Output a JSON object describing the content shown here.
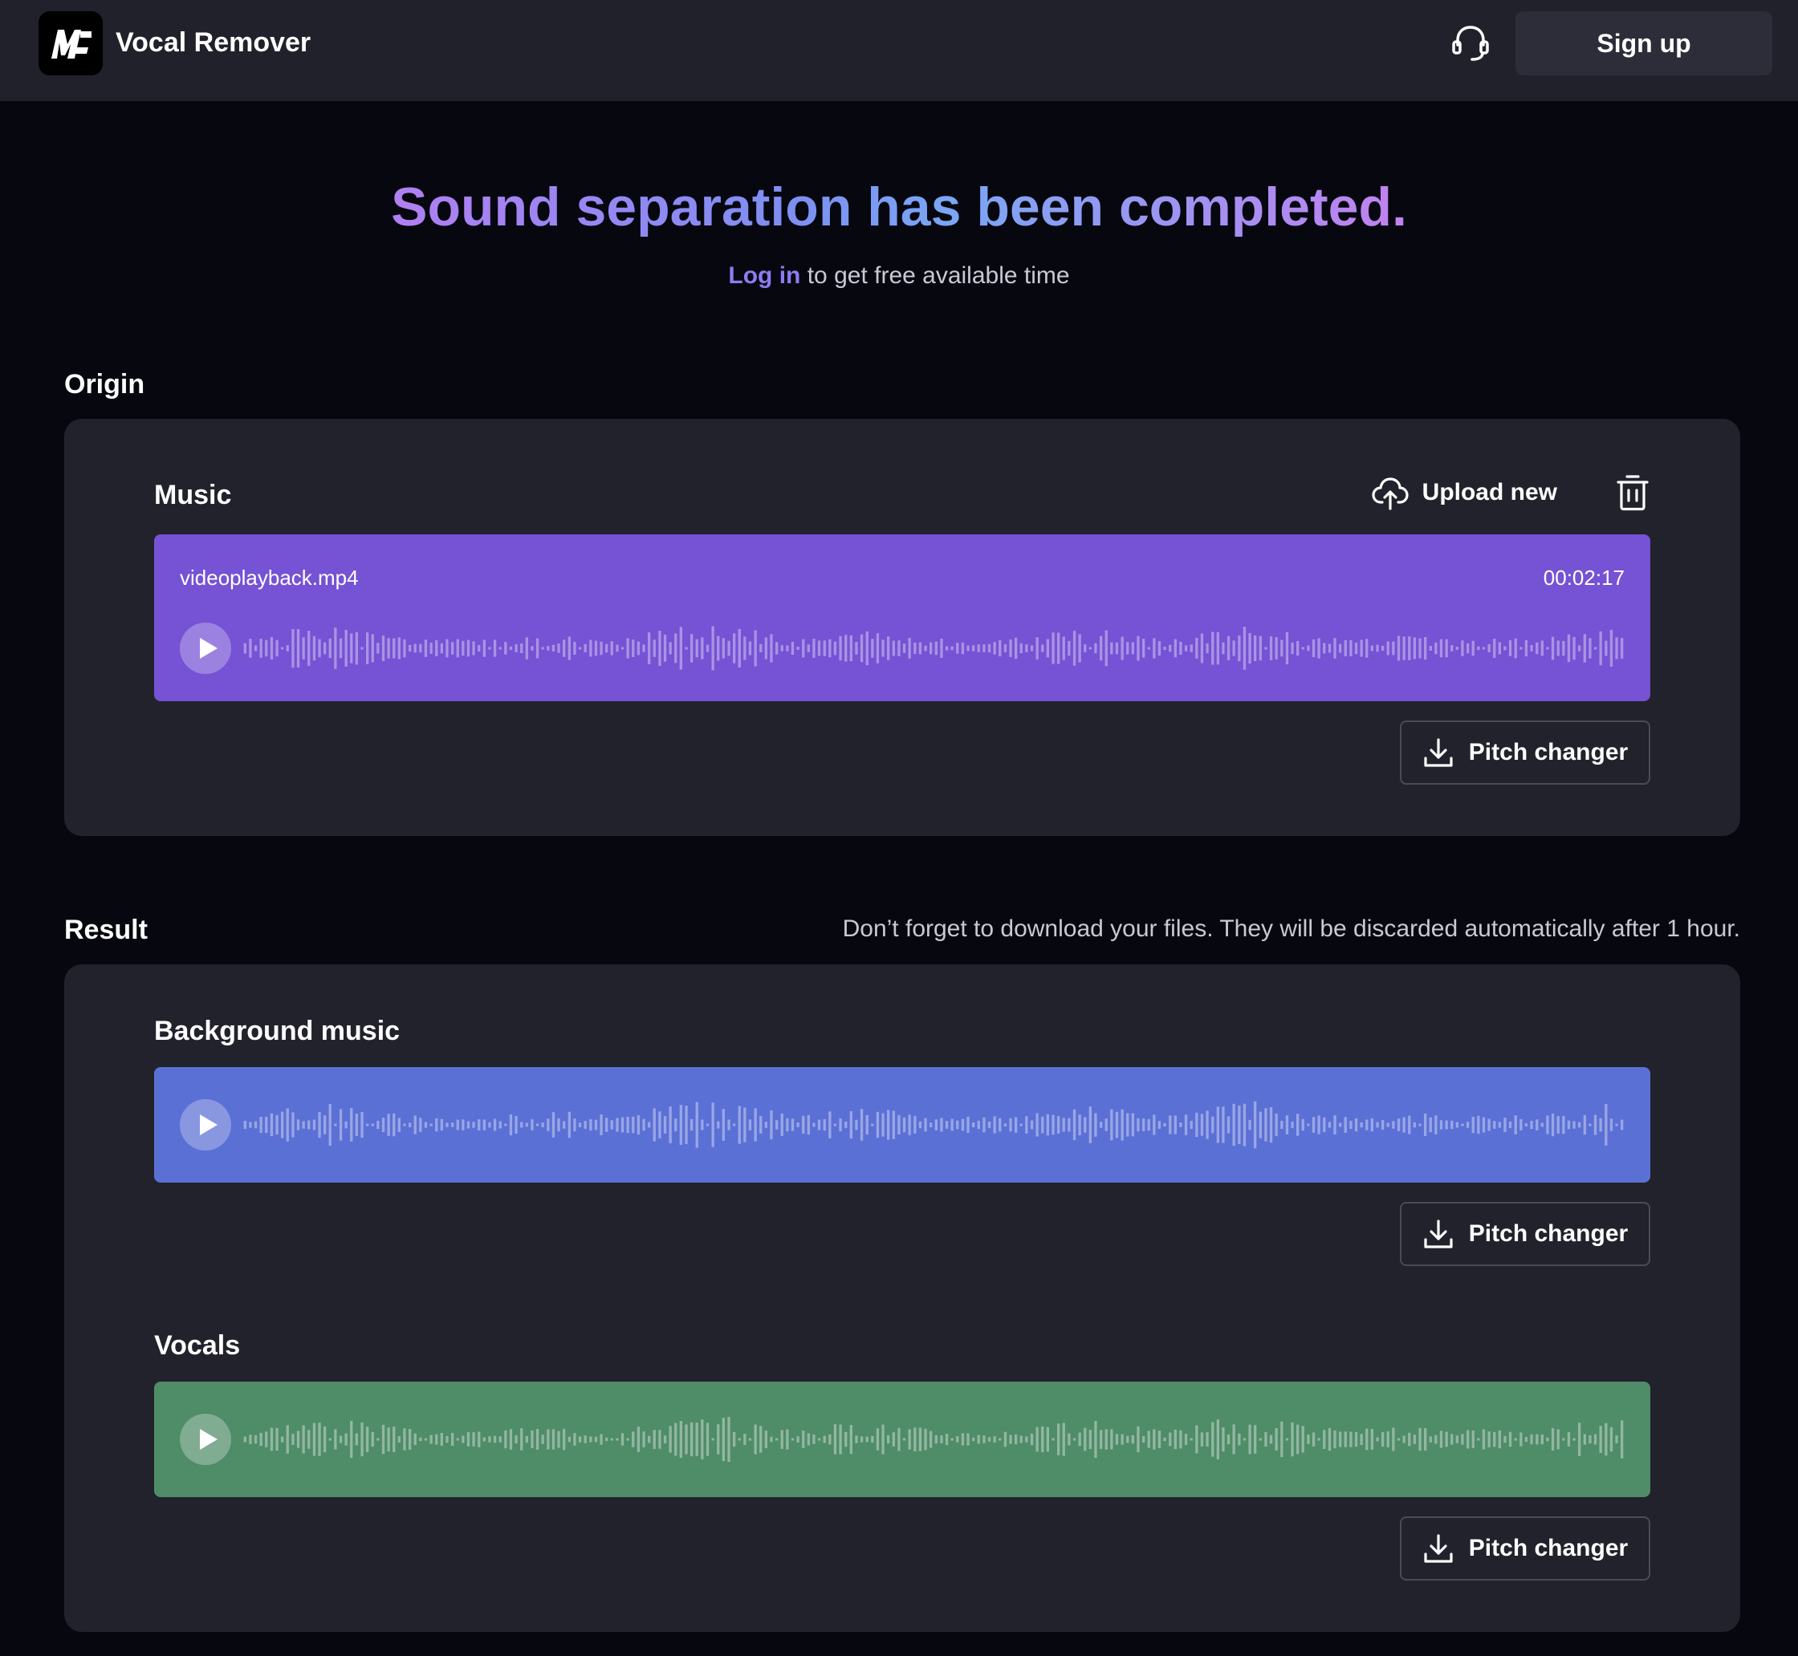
{
  "header": {
    "app_name": "Vocal Remover",
    "logo_icon": "mt-logo-icon",
    "support_icon": "headset-icon",
    "signup_label": "Sign up"
  },
  "hero": {
    "title": "Sound separation has been completed.",
    "login_link": "Log in",
    "login_suffix": " to get free available time"
  },
  "origin": {
    "section_label": "Origin",
    "track_title": "Music",
    "upload_label": "Upload new",
    "upload_icon": "cloud-upload-icon",
    "delete_icon": "trash-icon",
    "file_name": "videoplayback.mp4",
    "duration": "00:02:17",
    "player_color": "#7652d4",
    "pitch_label": "Pitch changer"
  },
  "result": {
    "section_label": "Result",
    "notice": "Don’t forget to download your files. They will be discarded automatically after 1 hour.",
    "tracks": [
      {
        "title": "Background music",
        "player_color": "#5b70d5",
        "pitch_label": "Pitch changer"
      },
      {
        "title": "Vocals",
        "player_color": "#4f8c68",
        "pitch_label": "Pitch changer"
      }
    ]
  },
  "colors": {
    "accent_link": "#8b7cf3",
    "page_bg": "#07070f",
    "card_bg": "#22222c",
    "header_bg": "#21212b"
  }
}
